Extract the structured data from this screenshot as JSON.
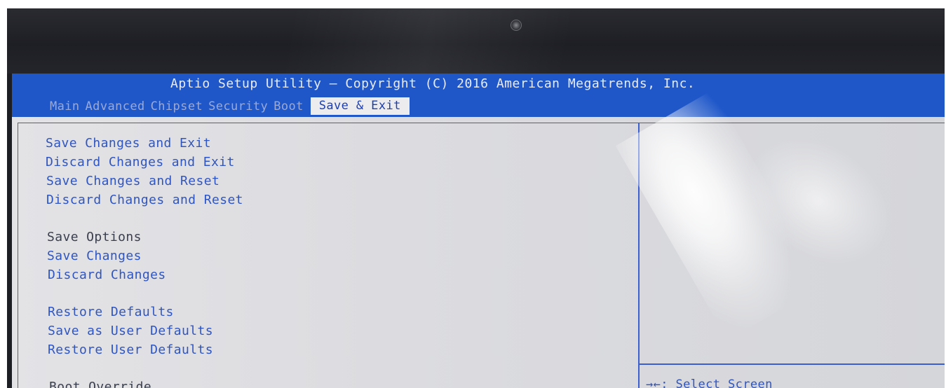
{
  "window": {
    "title": "Aptio Setup Utility – Copyright (C) 2016 American Megatrends, Inc."
  },
  "tabs": [
    {
      "label": "Main",
      "active": false
    },
    {
      "label": "Advanced",
      "active": false
    },
    {
      "label": "Chipset",
      "active": false
    },
    {
      "label": "Security",
      "active": false
    },
    {
      "label": "Boot",
      "active": false
    },
    {
      "label": "Save & Exit",
      "active": true
    }
  ],
  "menu": {
    "items": [
      {
        "label": "Save Changes and Exit",
        "type": "action"
      },
      {
        "label": "Discard Changes and Exit",
        "type": "action"
      },
      {
        "label": "Save Changes and Reset",
        "type": "action"
      },
      {
        "label": "Discard Changes and Reset",
        "type": "action"
      },
      {
        "label": "Save Options",
        "type": "header"
      },
      {
        "label": "Save Changes",
        "type": "action"
      },
      {
        "label": "Discard Changes",
        "type": "action"
      },
      {
        "label": "Restore Defaults",
        "type": "action"
      },
      {
        "label": "Save as User Defaults",
        "type": "action"
      },
      {
        "label": "Restore User Defaults",
        "type": "action"
      },
      {
        "label": "Boot Override",
        "type": "header"
      }
    ]
  },
  "help": {
    "keys": [
      {
        "key": "→←",
        "description": "Select Screen"
      }
    ],
    "first_line": "→←: Select Screen"
  },
  "colors": {
    "title_bar": "#1f57c9",
    "menu_text": "#2f55c0",
    "header_text": "#3a3f4e",
    "content_background": "#d8d9dd"
  }
}
